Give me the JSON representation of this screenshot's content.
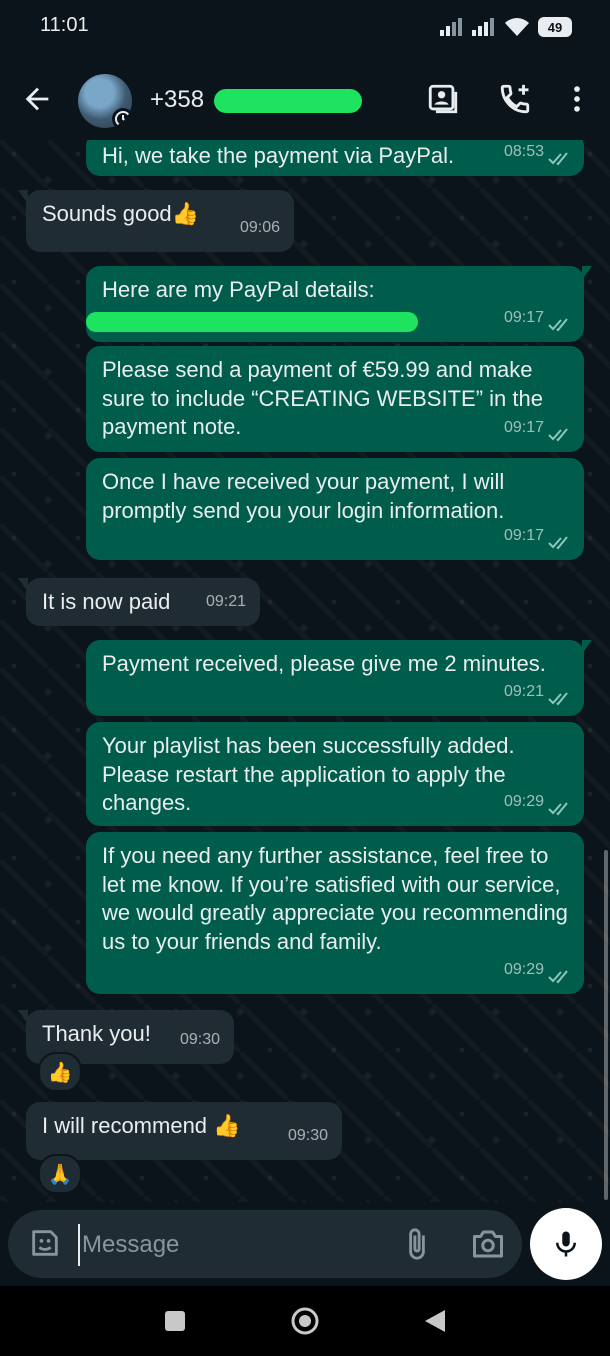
{
  "status_bar": {
    "time": "11:01",
    "battery": "49"
  },
  "header": {
    "contact": "+358"
  },
  "messages": [
    {
      "dir": "out",
      "text": "Hi, we take the payment via PayPal.",
      "time": "08:53"
    },
    {
      "dir": "in",
      "text": "Sounds good👍",
      "time": "09:06"
    },
    {
      "dir": "out",
      "text": "Here are my PayPal details:",
      "time": "09:17"
    },
    {
      "dir": "out",
      "text": "Please send a payment of €59.99 and make sure to include “CREATING WEBSITE” in the payment note.",
      "time": "09:17"
    },
    {
      "dir": "out",
      "text": "Once I have received your payment, I will promptly send you your login information.",
      "time": "09:17"
    },
    {
      "dir": "in",
      "text": "It is now paid",
      "time": "09:21"
    },
    {
      "dir": "out",
      "text": "Payment received, please give me 2 minutes.",
      "time": "09:21"
    },
    {
      "dir": "out",
      "text": "Your playlist has been successfully added. Please restart the application to apply the changes.",
      "time": "09:29"
    },
    {
      "dir": "out",
      "text": "If you need any further assistance, feel free to let me know. If you’re satisfied with our service, we would greatly appreciate you recommending us to your friends and family.",
      "time": "09:29"
    },
    {
      "dir": "in",
      "text": "Thank you!",
      "time": "09:30",
      "reaction": "👍"
    },
    {
      "dir": "in",
      "text": "I will recommend 👍",
      "time": "09:30",
      "reaction": "🙏"
    }
  ],
  "composer": {
    "placeholder": "Message"
  },
  "colors": {
    "outgoing": "#005c4b",
    "incoming": "#202c33",
    "ticks": "#8cc7ba",
    "background": "#0b141a"
  },
  "icons": [
    "back-arrow-icon",
    "contact-card-icon",
    "add-call-icon",
    "more-vert-icon",
    "emoji-icon",
    "attach-icon",
    "camera-icon",
    "mic-icon"
  ]
}
